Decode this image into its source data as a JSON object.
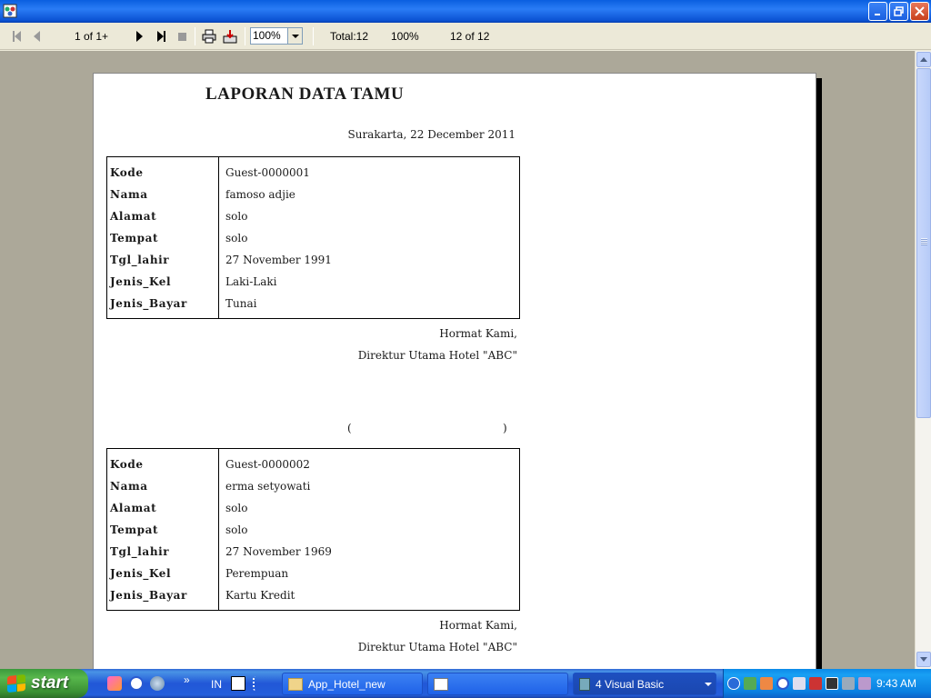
{
  "window": {
    "title": ""
  },
  "toolbar": {
    "page_indicator": "1 of 1+",
    "zoom_value": "100%",
    "total": "Total:12",
    "percent": "100%",
    "record_count": "12 of 12"
  },
  "report": {
    "title": "LAPORAN DATA TAMU",
    "date": "Surakarta, 22 December 2011",
    "field_labels": [
      "Kode",
      "Nama",
      "Alamat",
      "Tempat",
      "Tgl_lahir",
      "Jenis_Kel",
      "Jenis_Bayar"
    ],
    "records": [
      {
        "values": [
          "Guest-0000001",
          "famoso adjie",
          "solo",
          "solo",
          "27 November 1991",
          "Laki-Laki",
          "Tunai"
        ]
      },
      {
        "values": [
          "Guest-0000002",
          "erma setyowati",
          "solo",
          "solo",
          "27 November 1969",
          "Perempuan",
          "Kartu Kredit"
        ]
      }
    ],
    "closing": "Hormat Kami,",
    "signatory": "Direktur Utama Hotel \"ABC\"",
    "sig_open": "(",
    "sig_close": ")"
  },
  "taskbar": {
    "start_label": "start",
    "language": "IN",
    "chevron": "»",
    "items": [
      {
        "label": "App_Hotel_new"
      },
      {
        "label": ""
      },
      {
        "label": "4 Visual Basic"
      }
    ],
    "clock": "9:43 AM"
  }
}
